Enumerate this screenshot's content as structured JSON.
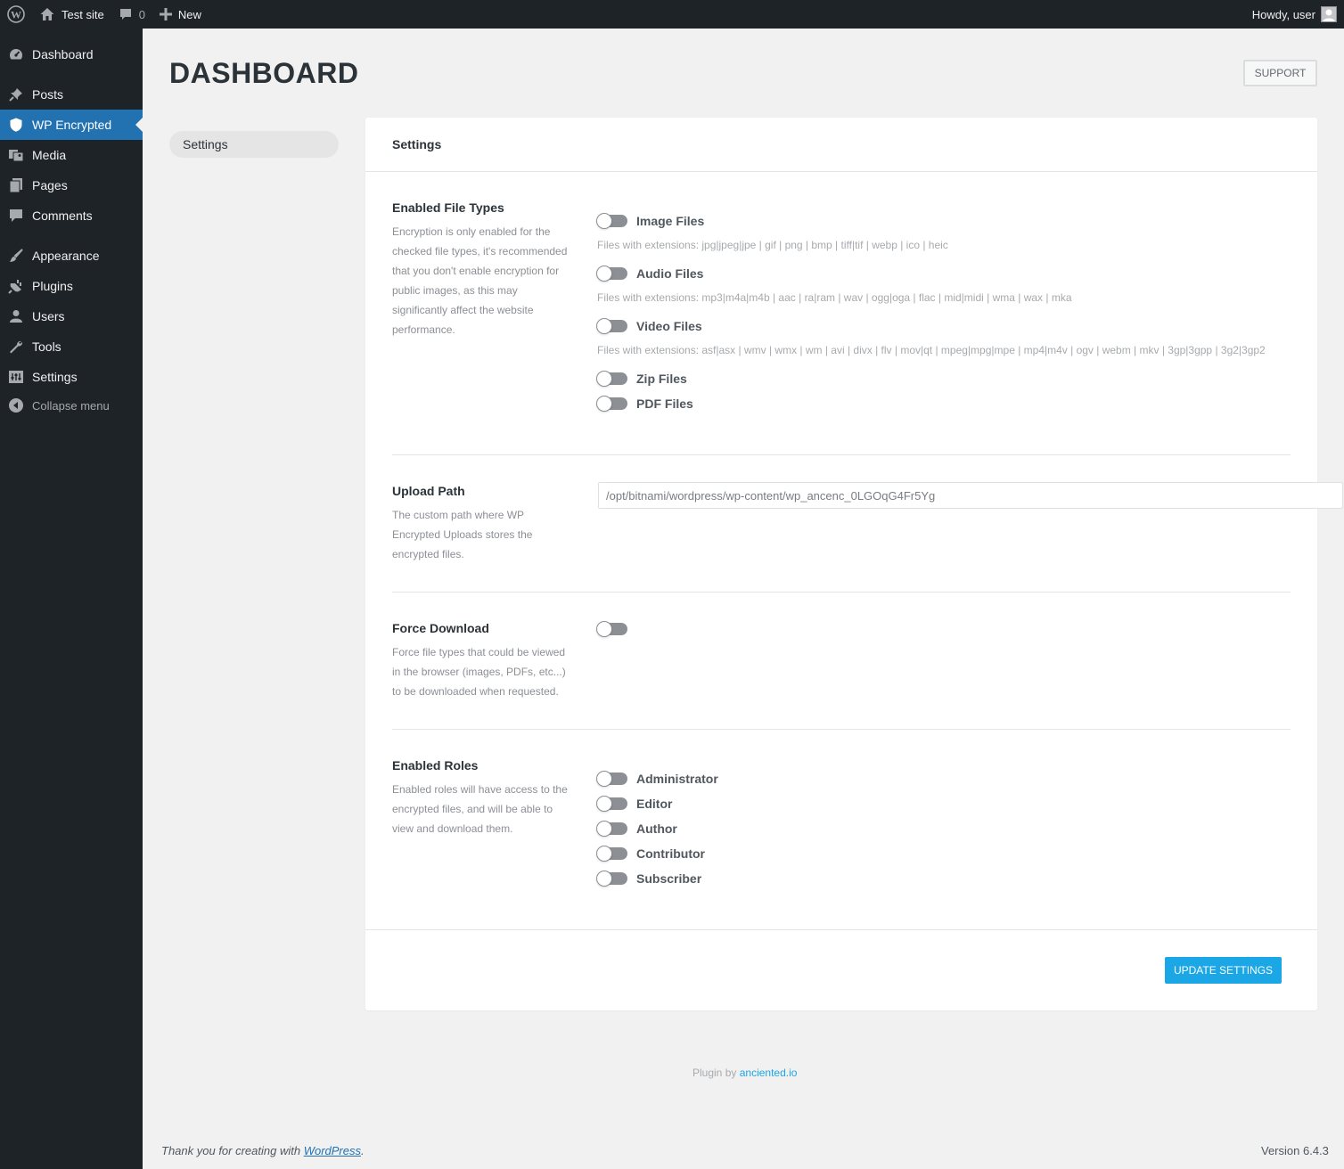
{
  "adminbar": {
    "site_name": "Test site",
    "comments_count": "0",
    "new_label": "New",
    "howdy": "Howdy, user"
  },
  "sidebar": {
    "items": [
      {
        "label": "Dashboard",
        "icon": "dashboard-icon"
      },
      {
        "label": "Posts",
        "icon": "pin-icon"
      },
      {
        "label": "WP Encrypted",
        "icon": "shield-icon",
        "active": true
      },
      {
        "label": "Media",
        "icon": "media-icon"
      },
      {
        "label": "Pages",
        "icon": "pages-icon"
      },
      {
        "label": "Comments",
        "icon": "comment-icon"
      },
      {
        "label": "Appearance",
        "icon": "brush-icon"
      },
      {
        "label": "Plugins",
        "icon": "plug-icon"
      },
      {
        "label": "Users",
        "icon": "user-icon"
      },
      {
        "label": "Tools",
        "icon": "wrench-icon"
      },
      {
        "label": "Settings",
        "icon": "settings-icon"
      }
    ],
    "collapse_label": "Collapse menu"
  },
  "header": {
    "title": "DASHBOARD",
    "support_label": "SUPPORT"
  },
  "tabs": {
    "settings": "Settings"
  },
  "card": {
    "title": "Settings",
    "file_types": {
      "title": "Enabled File Types",
      "desc": "Encryption is only enabled for the checked file types, it's recommended that you don't enable encryption for public images, as this may significantly affect the website performance.",
      "image": "Image Files",
      "image_ext": "Files with extensions: jpg|jpeg|jpe | gif | png | bmp | tiff|tif | webp | ico | heic",
      "audio": "Audio Files",
      "audio_ext": "Files with extensions: mp3|m4a|m4b | aac | ra|ram | wav | ogg|oga | flac | mid|midi | wma | wax | mka",
      "video": "Video Files",
      "video_ext": "Files with extensions: asf|asx | wmv | wmx | wm | avi | divx | flv | mov|qt | mpeg|mpg|mpe | mp4|m4v | ogv | webm | mkv | 3gp|3gpp | 3g2|3gp2",
      "zip": "Zip Files",
      "pdf": "PDF Files"
    },
    "upload_path": {
      "title": "Upload Path",
      "desc": "The custom path where WP Encrypted Uploads stores the encrypted files.",
      "value": "/opt/bitnami/wordpress/wp-content/wp_ancenc_0LGOqG4Fr5Yg"
    },
    "force_download": {
      "title": "Force Download",
      "desc": "Force file types that could be viewed in the browser (images, PDFs, etc...) to be downloaded when requested."
    },
    "roles": {
      "title": "Enabled Roles",
      "desc": "Enabled roles will have access to the encrypted files, and will be able to view and download them.",
      "administrator": "Administrator",
      "editor": "Editor",
      "author": "Author",
      "contributor": "Contributor",
      "subscriber": "Subscriber"
    },
    "update_label": "UPDATE SETTINGS"
  },
  "footer": {
    "plugin_by_prefix": "Plugin by",
    "plugin_by_link": "anciented.io",
    "thanks_prefix": "Thank you for creating with",
    "thanks_link": "WordPress",
    "thanks_suffix": ".",
    "version": "Version 6.4.3"
  }
}
